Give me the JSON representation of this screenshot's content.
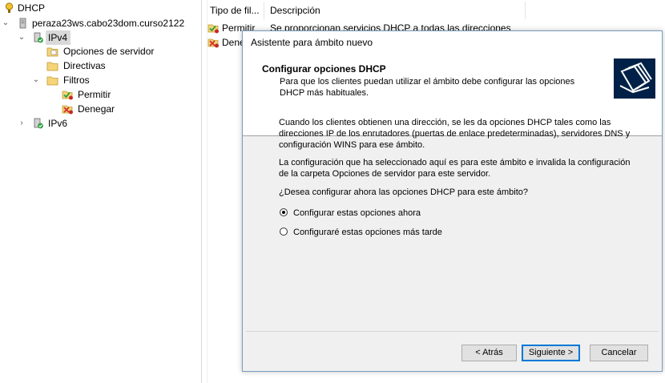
{
  "tree": {
    "root": "DHCP",
    "server": "peraza23ws.cabo23dom.curso2122",
    "ipv4": "IPv4",
    "server_options": "Opciones de servidor",
    "policies": "Directivas",
    "filters": "Filtros",
    "allow": "Permitir",
    "deny": "Denegar",
    "ipv6": "IPv6"
  },
  "list": {
    "columns": [
      "Tipo de fil...",
      "Descripción"
    ],
    "rows": [
      {
        "type": "Permitir",
        "description": "Se proporcionan servicios DHCP a todas las direcciones"
      },
      {
        "type": "Denegar",
        "description": ""
      }
    ]
  },
  "dialog": {
    "title": "Asistente para ámbito nuevo",
    "header_title": "Configurar opciones DHCP",
    "header_subtitle": "Para que los clientes puedan utilizar el ámbito debe configurar las opciones DHCP más habituales.",
    "paragraph1": "Cuando los clientes obtienen una dirección, se les da opciones DHCP tales como las direcciones IP de los enrutadores (puertas de enlace predeterminadas), servidores DNS y configuración WINS para ese ámbito.",
    "paragraph2": "La configuración que ha seleccionado aquí es para este ámbito e invalida la configuración de la carpeta Opciones de servidor para este servidor.",
    "question": "¿Desea configurar ahora las opciones DHCP para este ámbito?",
    "option_now": "Configurar estas opciones ahora",
    "option_later": "Configuraré estas opciones más tarde",
    "selected_option": "now",
    "back_button": "< Atrás",
    "next_button": "Siguiente >",
    "cancel_button": "Cancelar"
  },
  "colors": {
    "accent": "#0078d7",
    "emblem": "#002147"
  }
}
